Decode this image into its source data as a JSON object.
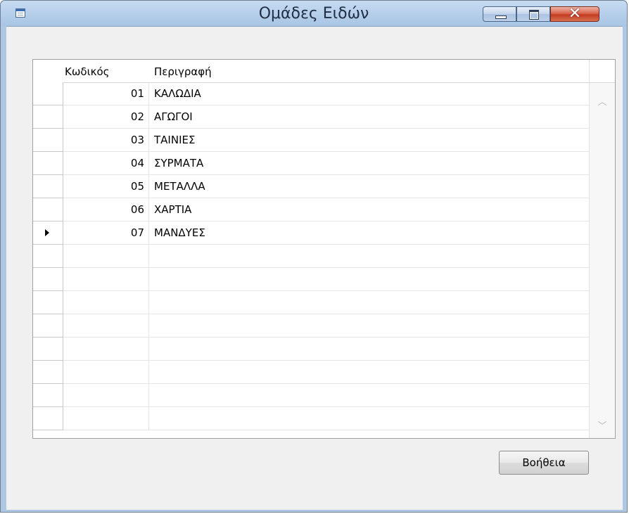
{
  "window": {
    "title": "Ομάδες Ειδών",
    "close_glyph": "✕"
  },
  "grid": {
    "columns": [
      "Κωδικός",
      "Περιγραφή"
    ],
    "rows": [
      {
        "code": "01",
        "description": "ΚΑΛΩΔΙΑ"
      },
      {
        "code": "02",
        "description": "ΑΓΩΓΟΙ"
      },
      {
        "code": "03",
        "description": "ΤΑΙΝΙΕΣ"
      },
      {
        "code": "04",
        "description": "ΣΥΡΜΑΤΑ"
      },
      {
        "code": "05",
        "description": "ΜΕΤΑΛΛΑ"
      },
      {
        "code": "06",
        "description": "ΧΑΡΤΙΑ"
      },
      {
        "code": "07",
        "description": "ΜΑΝΔΥΕΣ"
      }
    ],
    "empty_rows": 8,
    "current_row": 7,
    "current_row_icon": "row-pointer-triangle",
    "scroll_up_glyph": "︿",
    "scroll_down_glyph": "﹀"
  },
  "buttons": {
    "help_label": "Βοήθεια"
  },
  "icons": {
    "app": "table-window-icon",
    "minimize": "minimize-icon",
    "maximize": "maximize-icon",
    "close": "close-icon"
  },
  "colors": {
    "title_bar": "#b6cfea",
    "client_bg": "#f0f0f0",
    "close_button": "#c23b22"
  }
}
